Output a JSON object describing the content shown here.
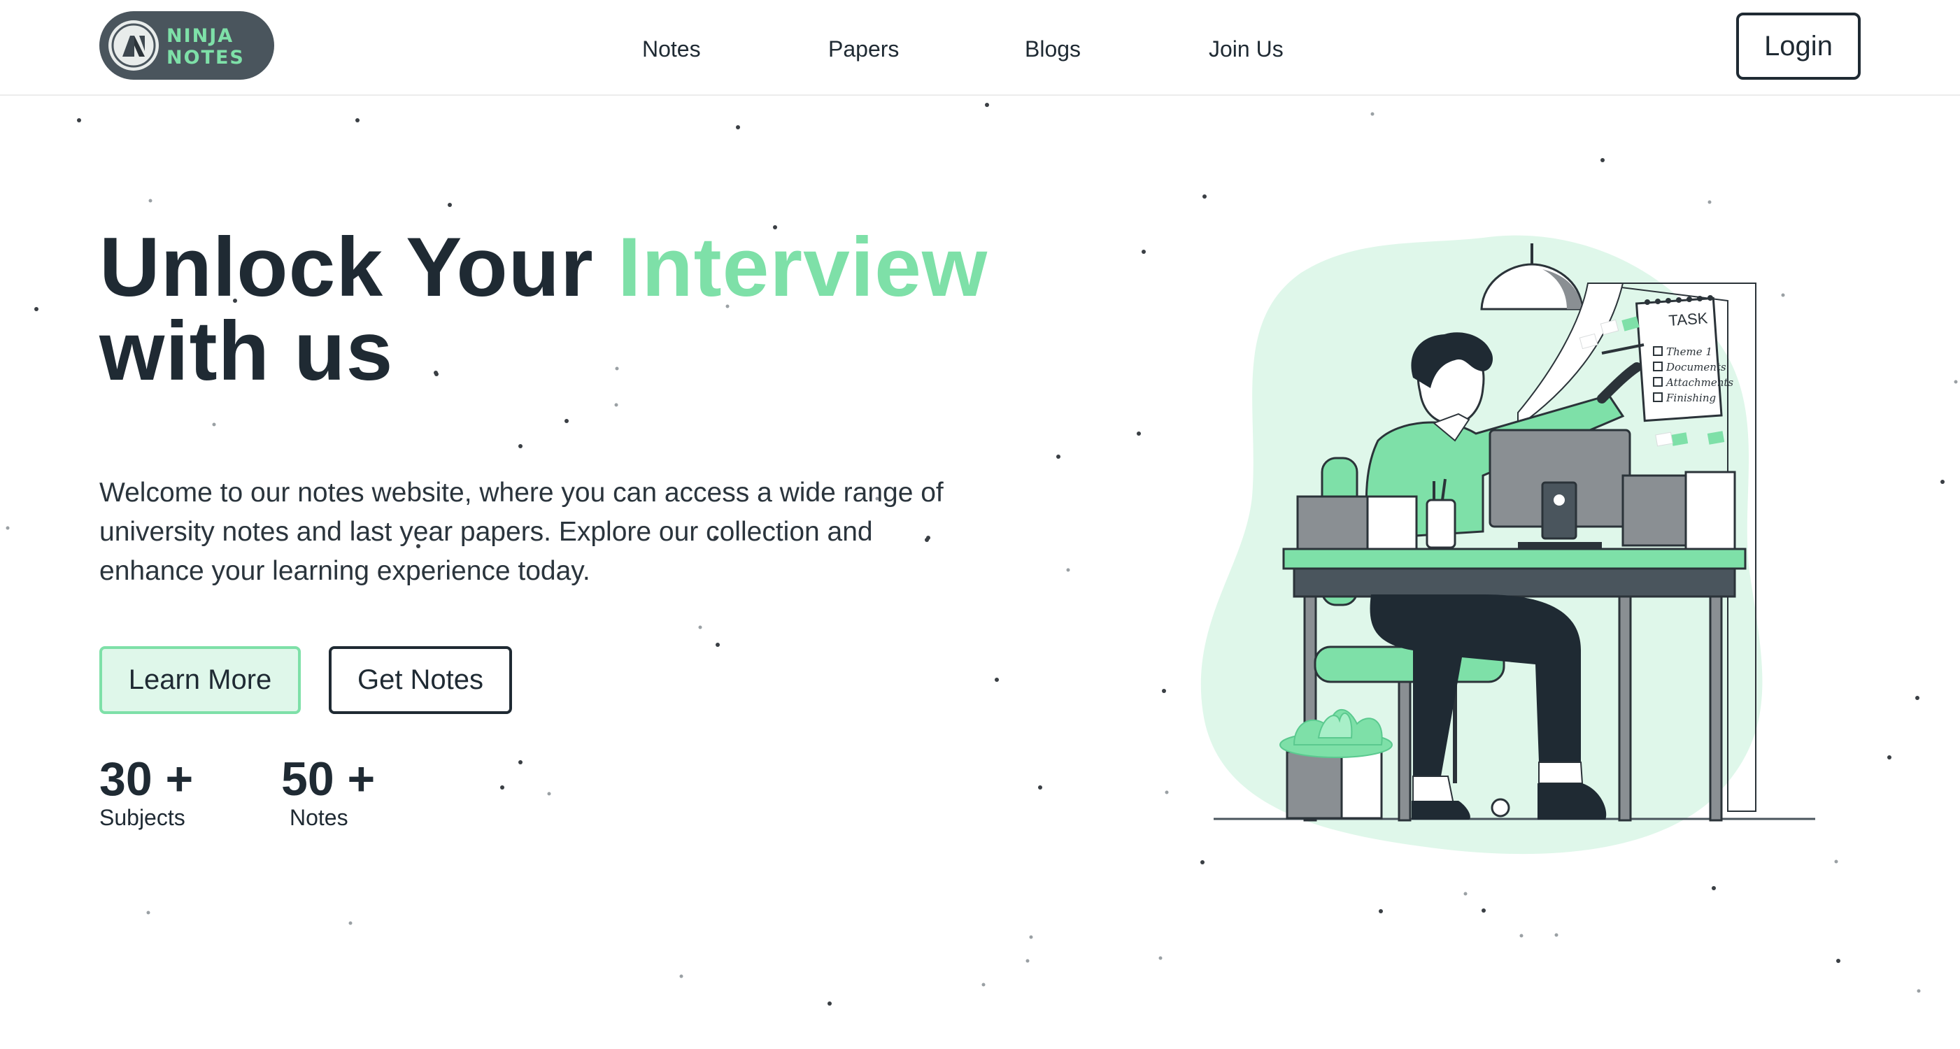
{
  "brand": {
    "line1": "NINJA",
    "line2": "NOTES",
    "accent_color": "#7ee0a8",
    "badge_color": "#4a555d"
  },
  "nav": {
    "items": [
      {
        "label": "Notes"
      },
      {
        "label": "Papers"
      },
      {
        "label": "Blogs"
      },
      {
        "label": "Join Us"
      }
    ]
  },
  "header": {
    "login_label": "Login"
  },
  "hero": {
    "title_part1": "Unlock Your ",
    "title_accent": "Interview",
    "title_part2": "with us",
    "description": "Welcome to our notes website, where you can access a wide range of university notes and last year papers. Explore our collection and enhance your learning experience today.",
    "learn_more_label": "Learn More",
    "get_notes_label": "Get Notes"
  },
  "stats": [
    {
      "value": "30 +",
      "label": "Subjects"
    },
    {
      "value": "50 +",
      "label": "Notes"
    }
  ],
  "illustration": {
    "task_title": "TASK",
    "task_items": [
      "Theme 1",
      "Documents",
      "Attachments",
      "Finishing"
    ],
    "icon": "person-at-desk-illustration"
  },
  "colors": {
    "text": "#1f2a33",
    "accent": "#7ee0a8",
    "accent_soft": "#dff7ea"
  }
}
